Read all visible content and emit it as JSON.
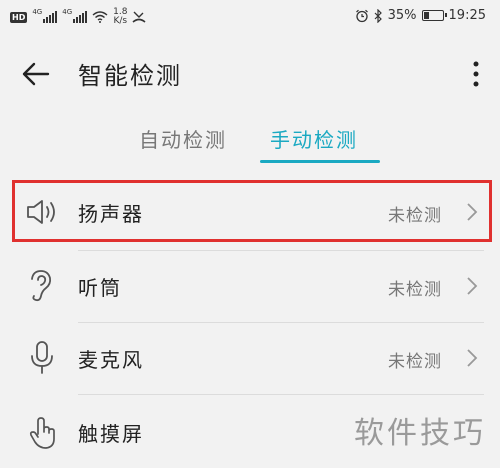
{
  "status_bar": {
    "hd": "HD",
    "net1": "4G",
    "net2": "4G",
    "speed_value": "1.8",
    "speed_unit": "K/s",
    "battery_percent": "35%",
    "battery_level": 0.35,
    "time": "19:25"
  },
  "header": {
    "title": "智能检测"
  },
  "tabs": [
    {
      "label": "自动检测",
      "active": false
    },
    {
      "label": "手动检测",
      "active": true
    }
  ],
  "items": [
    {
      "label": "扬声器",
      "status": "未检测",
      "icon": "speaker-icon",
      "highlighted": true
    },
    {
      "label": "听筒",
      "status": "未检测",
      "icon": "ear-icon"
    },
    {
      "label": "麦克风",
      "status": "未检测",
      "icon": "microphone-icon"
    },
    {
      "label": "触摸屏",
      "status": "",
      "icon": "touch-icon"
    }
  ],
  "watermark": "软件技巧",
  "colors": {
    "accent": "#1aa9c2",
    "highlight": "#e0312f",
    "background": "#f2f2f2"
  }
}
